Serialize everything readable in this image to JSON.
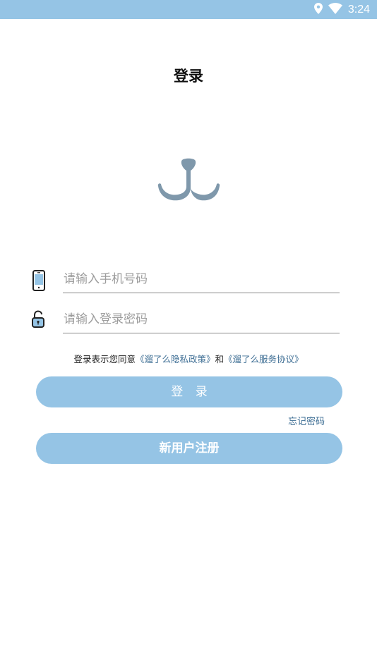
{
  "status_bar": {
    "time": "3:24",
    "icons": [
      "location-icon",
      "wifi-icon"
    ]
  },
  "page": {
    "title": "登录"
  },
  "form": {
    "phone": {
      "placeholder": "请输入手机号码",
      "value": "",
      "icon": "phone-icon"
    },
    "password": {
      "placeholder": "请输入登录密码",
      "value": "",
      "icon": "lock-icon"
    }
  },
  "agreement": {
    "prefix": "登录表示您同意",
    "privacy_link": "《遛了么隐私政策》",
    "conjunction": "和",
    "service_link": "《遛了么服务协议》"
  },
  "buttons": {
    "login": "登 录",
    "forgot_password": "忘记密码",
    "register": "新用户注册"
  },
  "colors": {
    "accent": "#95c4e5",
    "link": "#3f6f95",
    "logo": "#7f98ab",
    "placeholder": "#9c9c9c"
  }
}
